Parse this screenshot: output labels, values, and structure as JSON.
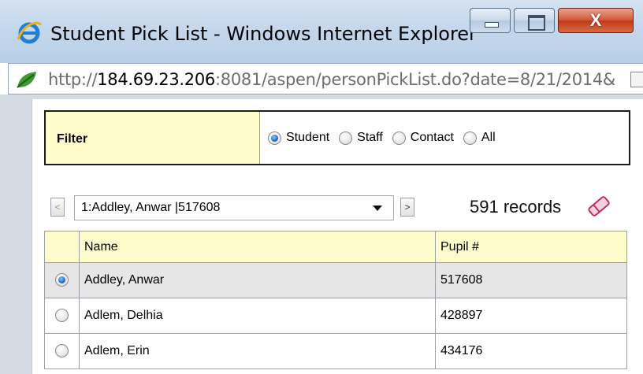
{
  "window": {
    "title": "Student Pick List - Windows Internet Explorer",
    "close_glyph": "X",
    "address": {
      "scheme": "http://",
      "host": "184.69.23.206",
      "rest": ":8081/aspen/personPickList.do?date=8/21/2014&"
    }
  },
  "filter": {
    "label": "Filter",
    "options": [
      {
        "label": "Student",
        "checked": true
      },
      {
        "label": "Staff",
        "checked": false
      },
      {
        "label": "Contact",
        "checked": false
      },
      {
        "label": "All",
        "checked": false
      }
    ]
  },
  "navigator": {
    "prev_label": "<",
    "next_label": ">",
    "selected": "1:Addley, Anwar |517608",
    "records": "591 records"
  },
  "table": {
    "headers": [
      "",
      "Name",
      "Pupil #"
    ],
    "rows": [
      {
        "name": "Addley, Anwar",
        "pupil": "517608",
        "selected": true
      },
      {
        "name": "Adlem, Delhia",
        "pupil": "428897",
        "selected": false
      },
      {
        "name": "Adlem, Erin",
        "pupil": "434176",
        "selected": false
      }
    ]
  },
  "colors": {
    "header_bg": "#fffccc",
    "selected_row_bg": "#e6e6e6",
    "content_bg": "#d4dbe3"
  },
  "icons": {
    "browser": "internet-explorer-icon",
    "site": "leaf-icon",
    "clear": "eraser-icon",
    "radio": "radio-button"
  }
}
